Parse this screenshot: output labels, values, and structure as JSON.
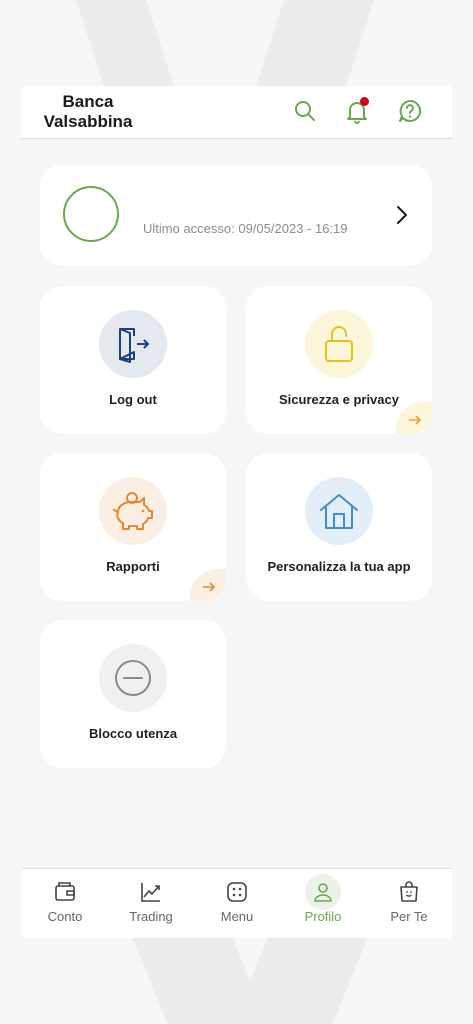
{
  "header": {
    "brand_line1": "Banca",
    "brand_line2": "Valsabbina",
    "icons": [
      "search-icon",
      "bell-icon",
      "help-icon"
    ]
  },
  "access_card": {
    "last_access": "Ultimo accesso: 09/05/2023 - 16:19"
  },
  "tiles": [
    {
      "label": "Log out",
      "icon": "logout-icon",
      "has_arrow": false
    },
    {
      "label": "Sicurezza e privacy",
      "icon": "lock-icon",
      "has_arrow": true
    },
    {
      "label": "Rapporti",
      "icon": "piggy-bank-icon",
      "has_arrow": true
    },
    {
      "label": "Personalizza la tua app",
      "icon": "home-icon",
      "has_arrow": false
    },
    {
      "label": "Blocco utenza",
      "icon": "block-icon",
      "has_arrow": false
    }
  ],
  "bottom_nav": [
    {
      "label": "Conto",
      "icon": "wallet-icon",
      "active": false
    },
    {
      "label": "Trading",
      "icon": "chart-icon",
      "active": false
    },
    {
      "label": "Menu",
      "icon": "menu-dice-icon",
      "active": false
    },
    {
      "label": "Profilo",
      "icon": "user-icon",
      "active": true
    },
    {
      "label": "Per Te",
      "icon": "gift-bag-icon",
      "active": false
    }
  ],
  "colors": {
    "accent_green": "#6aa84f",
    "notification_red": "#d0021b",
    "logout_blue": "#1f3f7a",
    "lock_yellow": "#e2c419",
    "piggy_orange": "#e8872e",
    "home_blue": "#3f8fcf",
    "block_grey": "#8a8a8a"
  }
}
